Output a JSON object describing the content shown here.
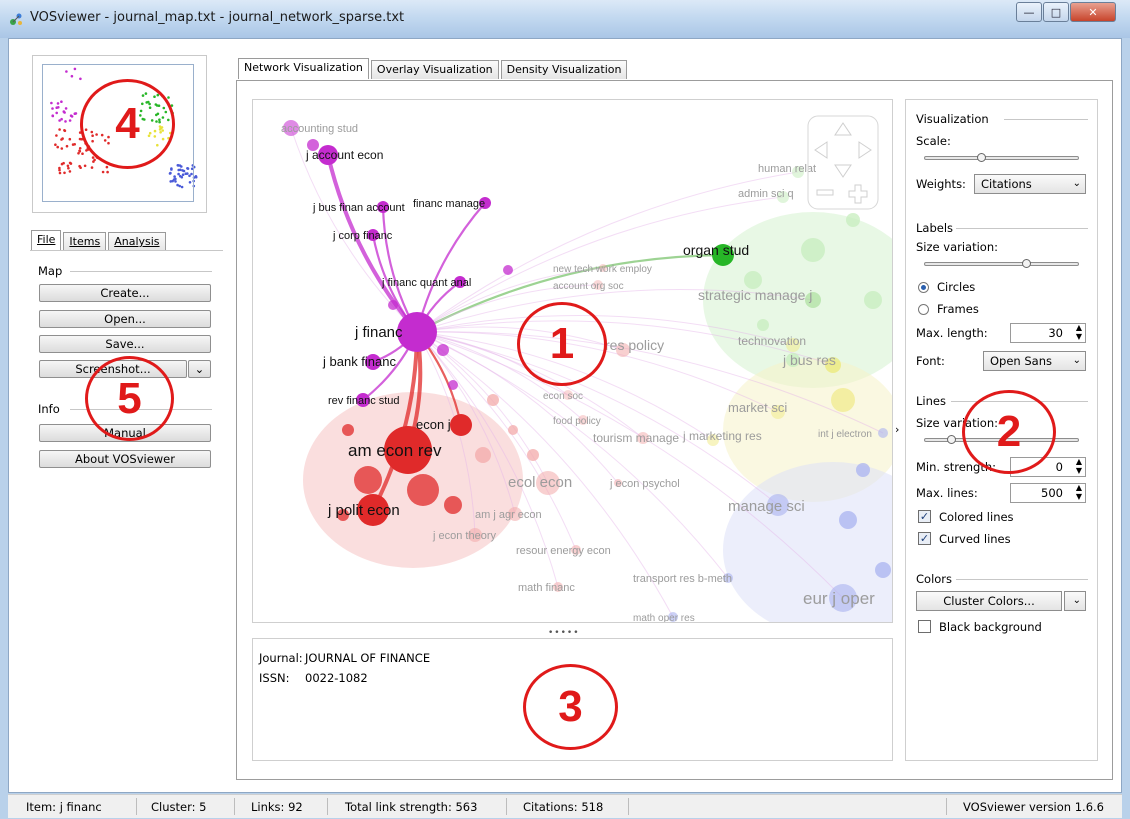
{
  "window": {
    "title": "VOSviewer - journal_map.txt - journal_network_sparse.txt",
    "controls": [
      "minimize",
      "maximize",
      "close"
    ]
  },
  "left_tabs": [
    {
      "label": "File",
      "active": true
    },
    {
      "label": "Items",
      "active": false
    },
    {
      "label": "Analysis",
      "active": false
    }
  ],
  "file_panel": {
    "map_section": "Map",
    "buttons": [
      "Create...",
      "Open...",
      "Save...",
      "Screenshot..."
    ],
    "info_section": "Info",
    "info_buttons": [
      "Manual",
      "About VOSviewer"
    ]
  },
  "viz_tabs": [
    {
      "label": "Network Visualization",
      "active": true
    },
    {
      "label": "Overlay Visualization",
      "active": false
    },
    {
      "label": "Density Visualization",
      "active": false
    }
  ],
  "network": {
    "labels": [
      "accounting stud",
      "j account econ",
      "j bus finan account",
      "financ manage",
      "j corp financ",
      "j financ quant anal",
      "j financ",
      "j bank financ",
      "rev financ stud",
      "econ j",
      "am econ rev",
      "j polit econ",
      "organ stud",
      "strategic manage j",
      "res policy",
      "technovation",
      "j bus res",
      "market sci",
      "j marketing res",
      "manage sci",
      "eur j oper",
      "tourism manage",
      "ecol econ",
      "j econ psychol",
      "am j agr econ",
      "j econ theory",
      "resour energy econ",
      "transport res b-meth",
      "math financ",
      "math oper res",
      "new tech work employ",
      "account org soc",
      "econ soc",
      "food policy",
      "human relat",
      "admin sci q",
      "int j electron"
    ]
  },
  "info": {
    "journal_label": "Journal:",
    "journal_value": "JOURNAL OF FINANCE",
    "issn_label": "ISSN:",
    "issn_value": "0022-1082"
  },
  "options": {
    "visualization": "Visualization",
    "scale": "Scale:",
    "weights_label": "Weights:",
    "weights_value": "Citations",
    "labels": "Labels",
    "size_variation": "Size variation:",
    "circles": "Circles",
    "frames": "Frames",
    "max_length_label": "Max. length:",
    "max_length_value": "30",
    "font_label": "Font:",
    "font_value": "Open Sans",
    "lines": "Lines",
    "lines_size_variation": "Size variation:",
    "min_strength_label": "Min. strength:",
    "min_strength_value": "0",
    "max_lines_label": "Max. lines:",
    "max_lines_value": "500",
    "colored_lines": "Colored lines",
    "curved_lines": "Curved lines",
    "colors": "Colors",
    "cluster_colors": "Cluster Colors...",
    "black_background": "Black background",
    "scale_level": 0.35,
    "label_size_level": 0.65,
    "line_size_level": 0.15
  },
  "status": {
    "item": "Item:  j financ",
    "cluster": "Cluster:  5",
    "links": "Links:  92",
    "total_link_strength": "Total link strength:  563",
    "citations": "Citations:  518",
    "version": "VOSviewer version 1.6.6"
  },
  "callouts": [
    "1",
    "2",
    "3",
    "4",
    "5"
  ],
  "colors": {
    "cluster_purple": "#c42ccf",
    "cluster_red": "#e02a2a",
    "cluster_green": "#27b627",
    "cluster_yellow": "#e8e23a",
    "cluster_blue": "#4a5ad8",
    "annotation_red": "#e01a1a"
  }
}
